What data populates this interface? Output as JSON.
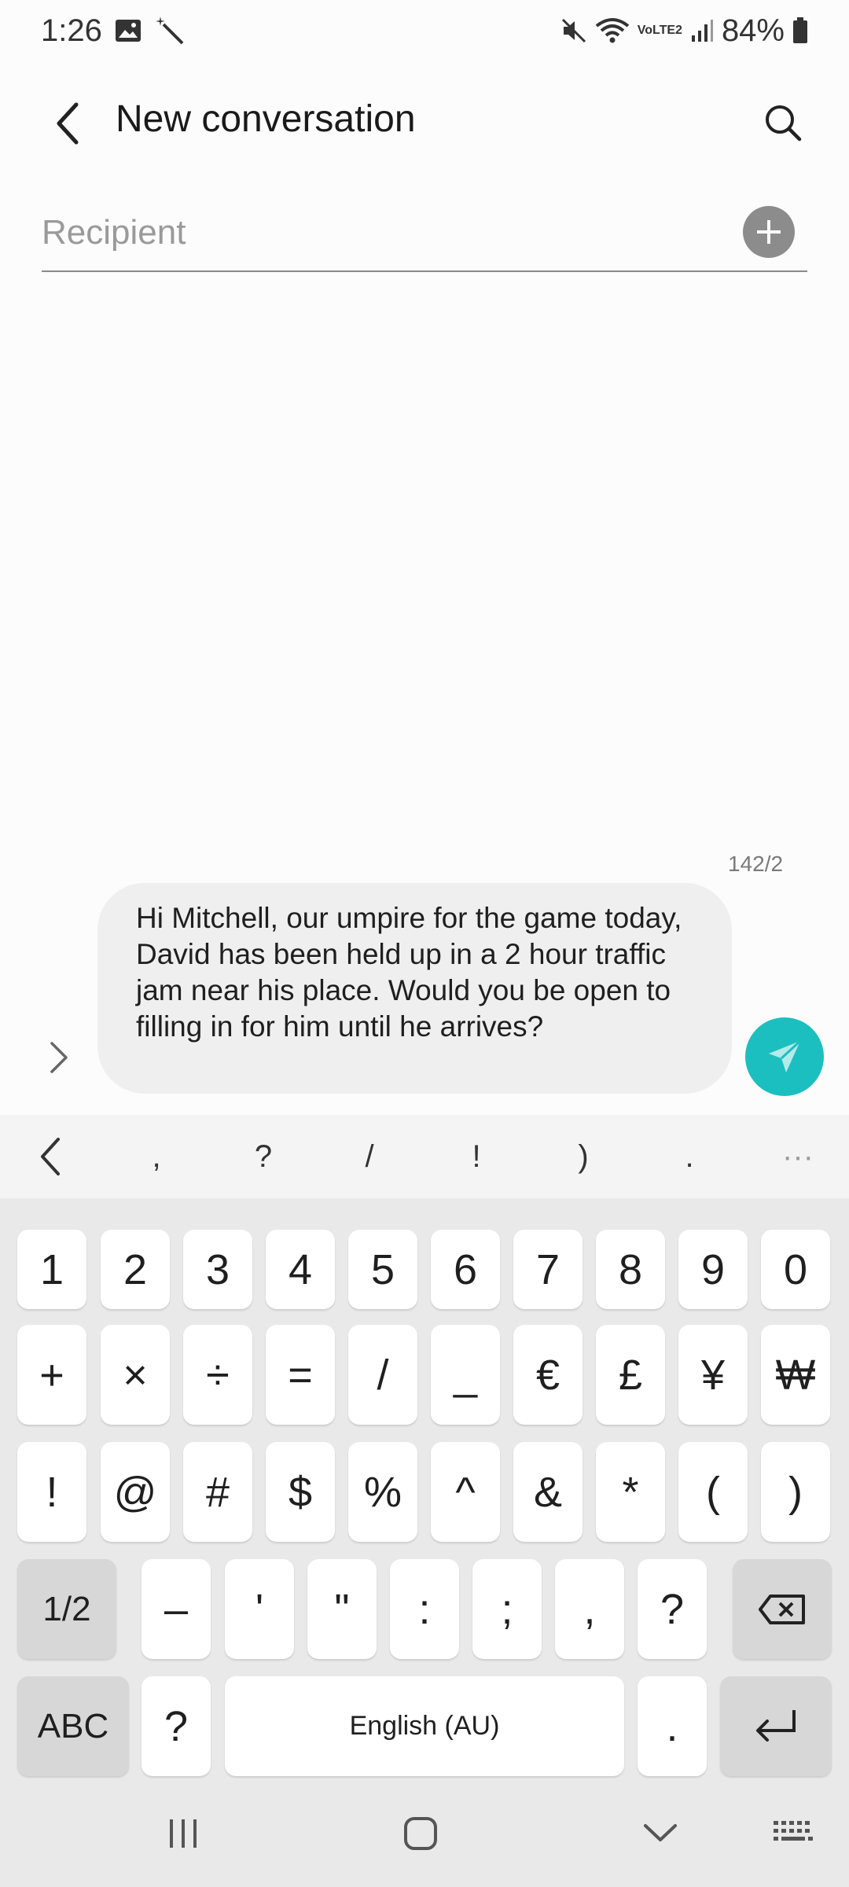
{
  "status_bar": {
    "time": "1:26",
    "battery": "84%",
    "network_label": "VoLTE2",
    "icons": [
      "image-icon",
      "magic-wand-icon",
      "mute-icon",
      "wifi-icon",
      "volte-icon",
      "signal-icon",
      "battery-icon"
    ]
  },
  "header": {
    "title": "New conversation",
    "icons": [
      "back-arrow-icon",
      "search-icon"
    ]
  },
  "recipient": {
    "placeholder": "Recipient",
    "value": "",
    "add_icon": "plus-icon"
  },
  "composer": {
    "counter": "142/2",
    "message": "Hi Mitchell, our umpire for the game today, David has been held up in a 2 hour traffic jam near his place. Would you be open to filling in for him until he arrives?",
    "send_icon": "send-icon",
    "expand_icon": "chevron-right-icon",
    "accent": "#1cbfbf"
  },
  "keyboard": {
    "toolbar": [
      "<",
      ",",
      "?",
      "/",
      "!",
      ")",
      ".",
      "···"
    ],
    "row1": [
      "1",
      "2",
      "3",
      "4",
      "5",
      "6",
      "7",
      "8",
      "9",
      "0"
    ],
    "row2": [
      "+",
      "×",
      "÷",
      "=",
      "/",
      "_",
      "€",
      "£",
      "¥",
      "₩"
    ],
    "row3": [
      "!",
      "@",
      "#",
      "$",
      "%",
      "^",
      "&",
      "*",
      "(",
      ")"
    ],
    "row4": [
      "1/2",
      "–",
      "'",
      "\"",
      ":",
      ";",
      ",",
      "?"
    ],
    "row5": {
      "abc": "ABC",
      "q": "?",
      "space": "English (AU)",
      "dot": "."
    }
  },
  "nav_bar": {
    "icons": [
      "recents-icon",
      "home-icon",
      "hide-keyboard-icon",
      "keyboard-switch-icon"
    ]
  }
}
